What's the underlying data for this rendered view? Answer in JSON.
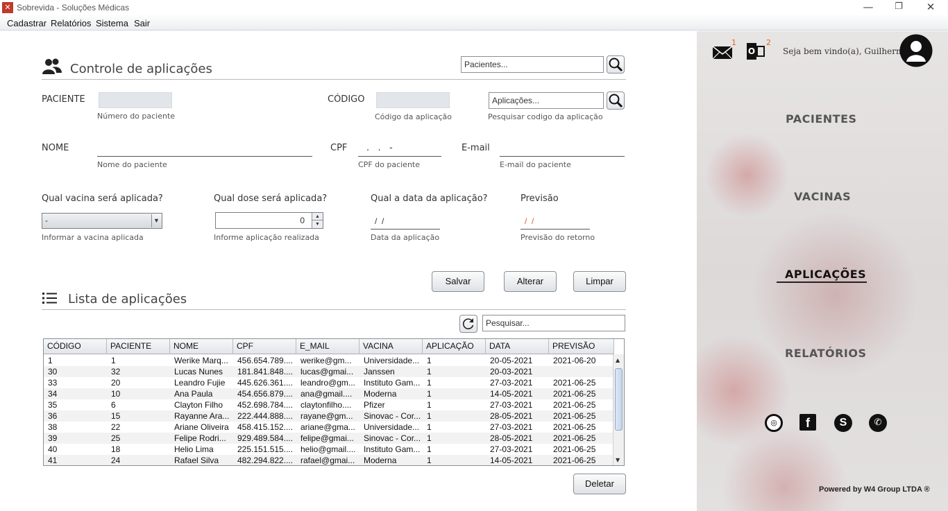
{
  "window": {
    "title": "Sobrevida - Soluções Médicas",
    "minimize": "—",
    "restore": "❐",
    "close": "✕"
  },
  "menu": [
    "Cadastrar",
    "Relatórios",
    "Sistema",
    "Sair"
  ],
  "form": {
    "title": "Controle de aplicações",
    "search_pacientes_placeholder": "Pacientes...",
    "search_aplicacoes_placeholder": "Aplicações...",
    "search_aplicacoes_hint": "Pesquisar codigo da aplicação",
    "paciente_label": "PACIENTE",
    "paciente_hint": "Número do paciente",
    "codigo_label": "CÓDIGO",
    "codigo_hint": "Código da aplicação",
    "nome_label": "NOME",
    "nome_hint": "Nome do paciente",
    "cpf_label": "CPF",
    "cpf_mask": ".   .   -",
    "cpf_hint": "CPF do paciente",
    "email_label": "E-mail",
    "email_hint": "E-mail do paciente",
    "vacina_question": "Qual vacina será aplicada?",
    "vacina_value": "-",
    "vacina_hint": "Informar a vacina aplicada",
    "dose_question": "Qual dose será aplicada?",
    "dose_value": "0",
    "dose_hint": "Informe aplicação realizada",
    "data_question": "Qual a data da aplicação?",
    "data_mask": "/  /",
    "data_hint": "Data da aplicação",
    "previsao_label": "Previsão",
    "previsao_mask": "/  /",
    "previsao_hint": "Previsão do retorno",
    "buttons": {
      "salvar": "Salvar",
      "alterar": "Alterar",
      "limpar": "Limpar",
      "deletar": "Deletar"
    }
  },
  "list": {
    "title": "Lista de aplicações",
    "search_placeholder": "Pesquisar...",
    "columns": [
      "CÓDIGO",
      "PACIENTE",
      "NOME",
      "CPF",
      "E_MAIL",
      "VACINA",
      "APLICAÇÃO",
      "DATA",
      "PREVISÃO"
    ],
    "rows": [
      [
        "1",
        "1",
        "Werike Marq...",
        "456.654.789....",
        "werike@gm...",
        "Universidade...",
        "1",
        "20-05-2021",
        "2021-06-20"
      ],
      [
        "30",
        "32",
        "Lucas Nunes",
        "181.841.848....",
        "lucas@gmai...",
        "Janssen",
        "1",
        "20-03-2021",
        ""
      ],
      [
        "33",
        "20",
        "Leandro Fujie",
        "445.626.361....",
        "leandro@gm...",
        "Instituto Gam...",
        "1",
        "27-03-2021",
        "2021-06-25"
      ],
      [
        "34",
        "10",
        "Ana Paula",
        "454.656.879....",
        "ana@gmail....",
        "Moderna",
        "1",
        "14-05-2021",
        "2021-06-25"
      ],
      [
        "35",
        "6",
        "Clayton Filho",
        "452.698.784....",
        "claytonfilho....",
        "Pfizer",
        "1",
        "27-03-2021",
        "2021-06-25"
      ],
      [
        "36",
        "15",
        "Rayanne Ara...",
        "222.444.888....",
        "rayane@gm...",
        "Sinovac - Cor...",
        "1",
        "28-05-2021",
        "2021-06-25"
      ],
      [
        "38",
        "22",
        "Ariane Oliveira",
        "458.415.152....",
        "ariane@gma...",
        "Universidade...",
        "1",
        "27-03-2021",
        "2021-06-25"
      ],
      [
        "39",
        "25",
        "Felipe Rodri...",
        "929.489.584....",
        "felipe@gmai...",
        "Sinovac - Cor...",
        "1",
        "28-05-2021",
        "2021-06-25"
      ],
      [
        "40",
        "18",
        "Helio Lima",
        "225.151.515....",
        "helio@gmail....",
        "Instituto Gam...",
        "1",
        "27-03-2021",
        "2021-06-25"
      ],
      [
        "41",
        "24",
        "Rafael Silva",
        "482.294.822....",
        "rafael@gmai...",
        "Moderna",
        "1",
        "14-05-2021",
        "2021-06-25"
      ]
    ]
  },
  "sidebar": {
    "close": "✕",
    "mail_badge": "1",
    "outlook_badge": "2",
    "outlook_glyph": "O",
    "welcome": "Seja bem vindo(a), Guilherme!",
    "nav": [
      "PACIENTES",
      "VACINAS",
      "APLICAÇÕES",
      "RELATÓRIOS"
    ],
    "active_nav": "APLICAÇÕES",
    "footer": "Powered by W4 Group LTDA ®"
  }
}
